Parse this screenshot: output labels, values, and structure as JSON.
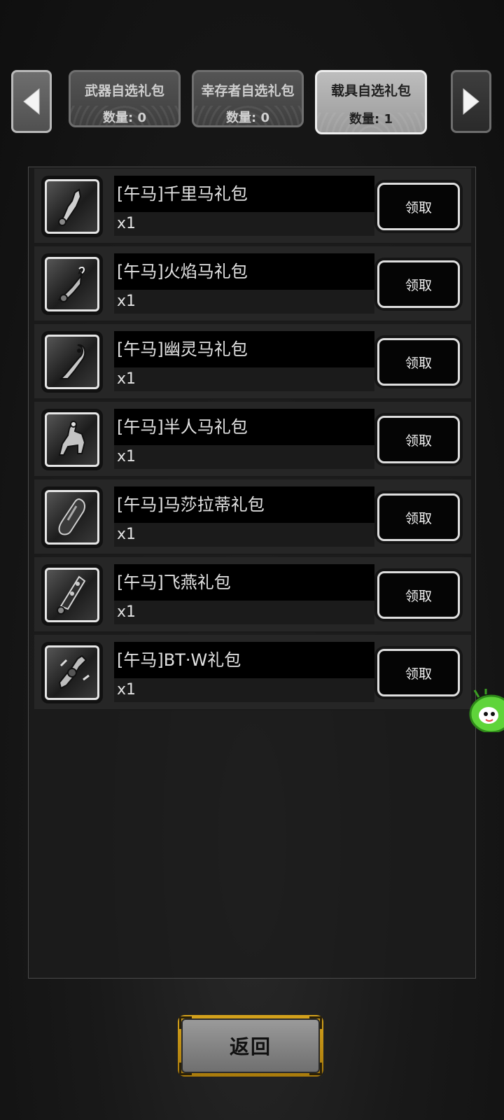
{
  "tabs": [
    {
      "title": "武器自选礼包",
      "count": "数量: 0",
      "active": false
    },
    {
      "title": "幸存者自选礼包",
      "count": "数量: 0",
      "active": false
    },
    {
      "title": "载具自选礼包",
      "count": "数量: 1",
      "active": true
    }
  ],
  "navigation": {
    "prev_icon": "triangle-left-icon",
    "next_icon": "triangle-right-icon"
  },
  "items": [
    {
      "name": "[午马]千里马礼包",
      "qty": "x1",
      "claim": "领取",
      "icon": "horse-vehicle-icon"
    },
    {
      "name": "[午马]火焰马礼包",
      "qty": "x1",
      "claim": "领取",
      "icon": "flame-horse-icon"
    },
    {
      "name": "[午马]幽灵马礼包",
      "qty": "x1",
      "claim": "领取",
      "icon": "ghost-horse-icon"
    },
    {
      "name": "[午马]半人马礼包",
      "qty": "x1",
      "claim": "领取",
      "icon": "centaur-icon"
    },
    {
      "name": "[午马]马莎拉蒂礼包",
      "qty": "x1",
      "claim": "领取",
      "icon": "car-icon"
    },
    {
      "name": "[午马]飞燕礼包",
      "qty": "x1",
      "claim": "领取",
      "icon": "hoverboard-icon"
    },
    {
      "name": "[午马]BT·W礼包",
      "qty": "x1",
      "claim": "领取",
      "icon": "motorbike-icon"
    }
  ],
  "footer": {
    "back_label": "返回"
  },
  "colors": {
    "accent_gold": "#d4a21c",
    "mascot_green": "#5fd43a"
  }
}
